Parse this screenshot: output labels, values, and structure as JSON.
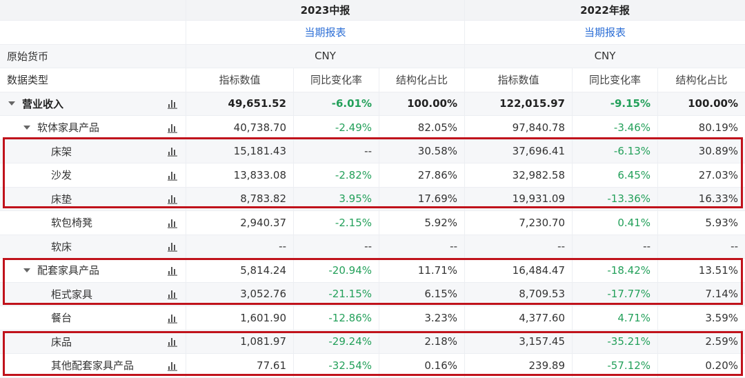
{
  "periods": [
    {
      "title": "2023中报",
      "report": "当期报表",
      "currency": "CNY"
    },
    {
      "title": "2022年报",
      "report": "当期报表",
      "currency": "CNY"
    }
  ],
  "labels": {
    "currency_row": "原始货币",
    "type_row": "数据类型"
  },
  "col_headers": [
    "指标数值",
    "同比变化率",
    "结构化占比",
    "指标数值",
    "同比变化率",
    "结构化占比"
  ],
  "rows": [
    {
      "name": "营业收入",
      "v": [
        "49,651.52",
        "-6.01%",
        "100.00%",
        "122,015.97",
        "-9.15%",
        "100.00%"
      ]
    },
    {
      "name": "软体家具产品",
      "v": [
        "40,738.70",
        "-2.49%",
        "82.05%",
        "97,840.78",
        "-3.46%",
        "80.19%"
      ]
    },
    {
      "name": "床架",
      "v": [
        "15,181.43",
        "--",
        "30.58%",
        "37,696.41",
        "-6.13%",
        "30.89%"
      ]
    },
    {
      "name": "沙发",
      "v": [
        "13,833.08",
        "-2.82%",
        "27.86%",
        "32,982.58",
        "6.45%",
        "27.03%"
      ]
    },
    {
      "name": "床垫",
      "v": [
        "8,783.82",
        "3.95%",
        "17.69%",
        "19,931.09",
        "-13.36%",
        "16.33%"
      ]
    },
    {
      "name": "软包椅凳",
      "v": [
        "2,940.37",
        "-2.15%",
        "5.92%",
        "7,230.70",
        "0.41%",
        "5.93%"
      ]
    },
    {
      "name": "软床",
      "v": [
        "--",
        "--",
        "--",
        "--",
        "--",
        "--"
      ]
    },
    {
      "name": "配套家具产品",
      "v": [
        "5,814.24",
        "-20.94%",
        "11.71%",
        "16,484.47",
        "-18.42%",
        "13.51%"
      ]
    },
    {
      "name": "柜式家具",
      "v": [
        "3,052.76",
        "-21.15%",
        "6.15%",
        "8,709.53",
        "-17.77%",
        "7.14%"
      ]
    },
    {
      "name": "餐台",
      "v": [
        "1,601.90",
        "-12.86%",
        "3.23%",
        "4,377.60",
        "4.71%",
        "3.59%"
      ]
    },
    {
      "name": "床品",
      "v": [
        "1,081.97",
        "-29.24%",
        "2.18%",
        "3,157.45",
        "-35.21%",
        "2.59%"
      ]
    },
    {
      "name": "其他配套家具产品",
      "v": [
        "77.61",
        "-32.54%",
        "0.16%",
        "239.89",
        "-57.12%",
        "0.20%"
      ]
    }
  ],
  "colors": {
    "accent": "#2d6fd6",
    "green": "#23a05a",
    "highlight": "#c0121b"
  }
}
